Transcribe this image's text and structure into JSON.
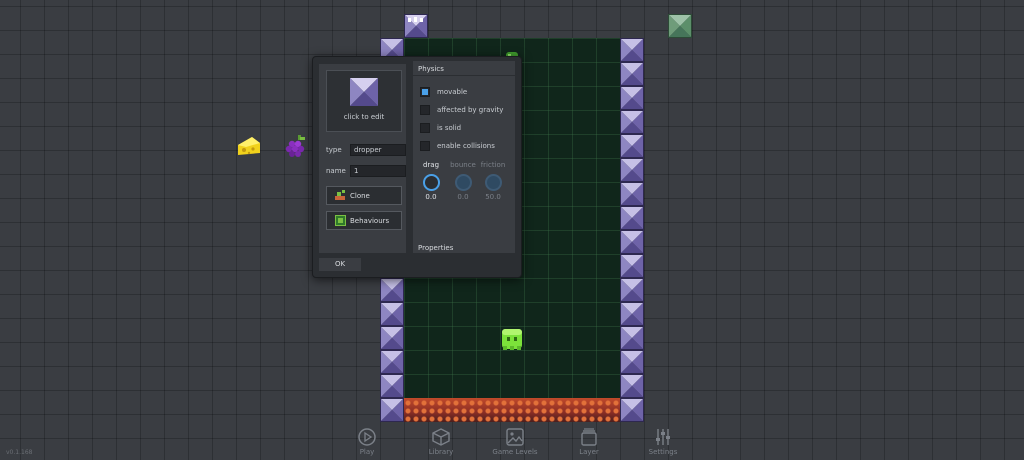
{
  "version": "v0.1.168",
  "colors": {
    "accent": "#4aa0e8",
    "level_background": "#10261b",
    "tile_top": "#c6c0e6",
    "tile_side": "#6e63a8",
    "grass_tile": "#5c8f6a"
  },
  "dialog": {
    "sprite_caption": "click to edit",
    "type_label": "type",
    "type_value": "dropper",
    "name_label": "name",
    "name_value": "1",
    "clone_label": "Clone",
    "behaviours_label": "Behaviours",
    "ok_label": "OK",
    "physics": {
      "title": "Physics",
      "options": [
        {
          "label": "movable",
          "checked": true
        },
        {
          "label": "affected by gravity",
          "checked": false
        },
        {
          "label": "is solid",
          "checked": false
        },
        {
          "label": "enable collisions",
          "checked": false
        }
      ],
      "knobs": [
        {
          "label": "drag",
          "value": "0.0",
          "active": true
        },
        {
          "label": "bounce",
          "value": "0.0",
          "active": false
        },
        {
          "label": "friction",
          "value": "50.0",
          "active": false
        }
      ]
    },
    "properties_title": "Properties"
  },
  "toolbar": [
    {
      "label": "Play",
      "icon": "play-icon"
    },
    {
      "label": "Library",
      "icon": "box-icon"
    },
    {
      "label": "Game Levels",
      "icon": "image-icon"
    },
    {
      "label": "Layer",
      "icon": "layers-icon"
    },
    {
      "label": "Settings",
      "icon": "sliders-icon"
    }
  ],
  "sprites": {
    "cheese": "cheese-sprite",
    "grapes": "grapes-sprite",
    "slime": "green-slime-sprite",
    "dropper": "dropper-sprite"
  }
}
